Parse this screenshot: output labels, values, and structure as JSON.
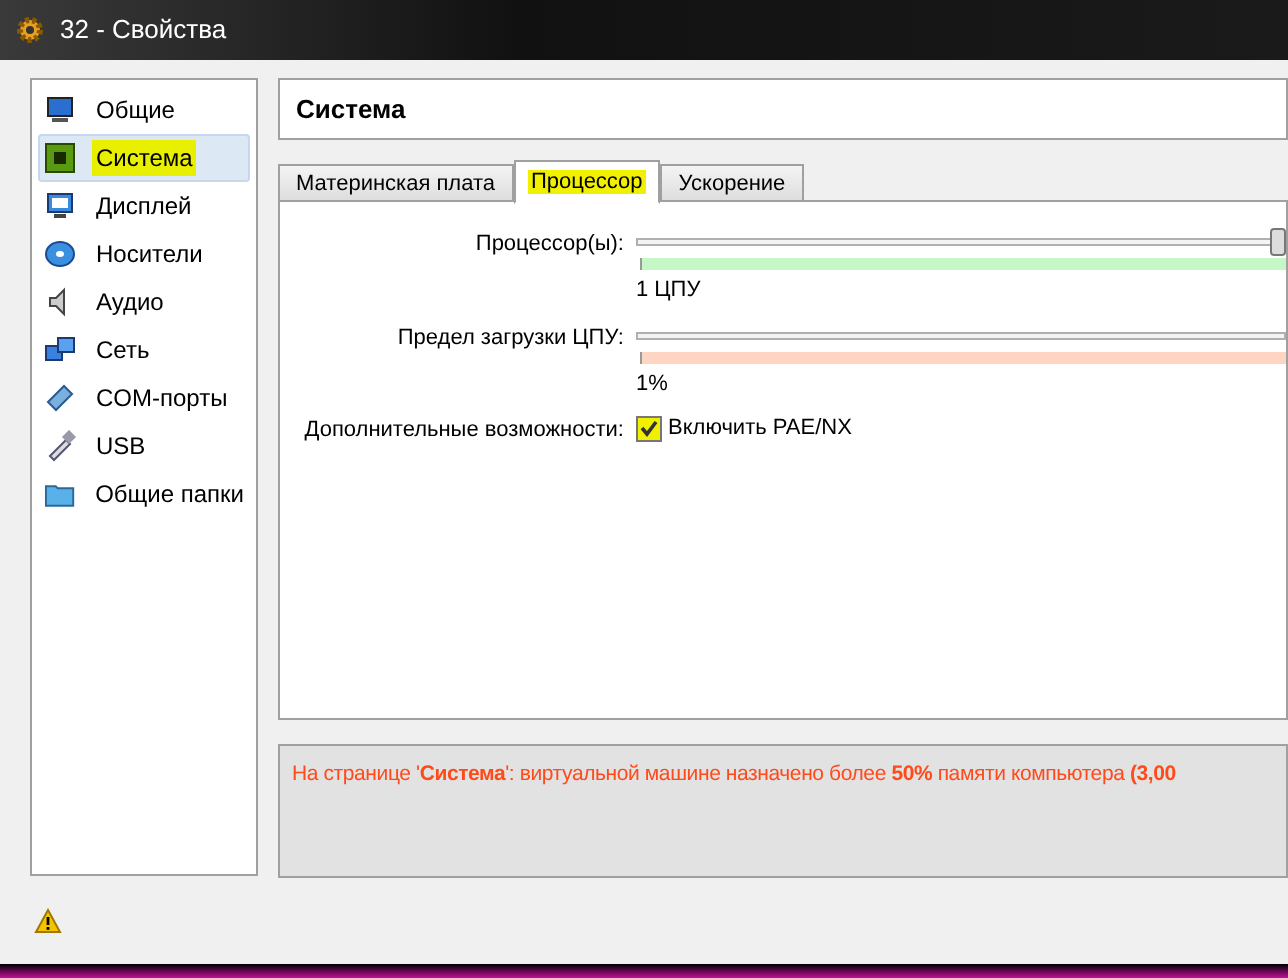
{
  "window": {
    "title": "32 - Свойства"
  },
  "sidebar": {
    "items": [
      {
        "label": "Общие",
        "selected": false
      },
      {
        "label": "Система",
        "selected": true
      },
      {
        "label": "Дисплей",
        "selected": false
      },
      {
        "label": "Носители",
        "selected": false
      },
      {
        "label": "Аудио",
        "selected": false
      },
      {
        "label": "Сеть",
        "selected": false
      },
      {
        "label": "COM-порты",
        "selected": false
      },
      {
        "label": "USB",
        "selected": false
      },
      {
        "label": "Общие папки",
        "selected": false
      }
    ]
  },
  "page_title": "Система",
  "tabs": [
    {
      "label": "Материнская плата",
      "selected": false
    },
    {
      "label": "Процессор",
      "selected": true
    },
    {
      "label": "Ускорение",
      "selected": false
    }
  ],
  "settings": [
    {
      "kind": "slider",
      "label": "Процессор(ы):",
      "level": 1,
      "min_label": "1 ЦПУ"
    },
    {
      "kind": "slider",
      "label": "Предел загрузки ЦПУ:",
      "min_label": "1%"
    },
    {
      "kind": "checkbox",
      "label": "Дополнительные возможности:",
      "option": "Включить PAE/NX",
      "checked": true
    }
  ],
  "message": "На странице '**Система**': виртуальной машине назначено более **50%** памяти компьютера **(3,00**"
}
